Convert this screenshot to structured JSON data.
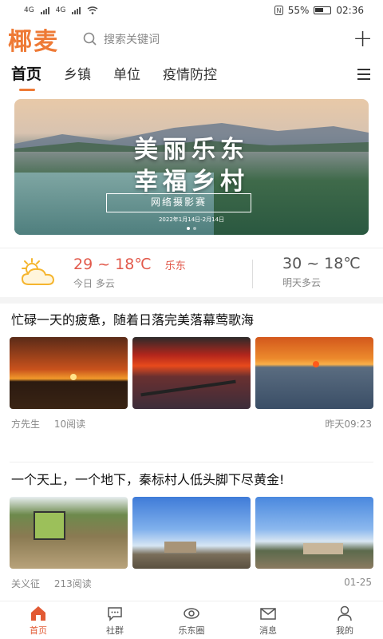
{
  "status_bar": {
    "network1": "4G",
    "network2": "4G",
    "battery": "55%",
    "time": "02:36"
  },
  "header": {
    "logo": "椰麦",
    "search_placeholder": "搜索关键词"
  },
  "tabs": [
    {
      "label": "首页"
    },
    {
      "label": "乡镇"
    },
    {
      "label": "单位"
    },
    {
      "label": "疫情防控"
    }
  ],
  "banner": {
    "title_line1": "美丽乐东",
    "title_line2": "幸福乡村",
    "subtitle": "网络摄影赛",
    "date": "2022年1月14日-2月14日"
  },
  "weather": {
    "today_temp": "29 ~ 18℃",
    "city": "乐东",
    "today_desc": "今日 多云",
    "tomorrow_temp": "30 ~ 18℃",
    "tomorrow_desc": "明天多云"
  },
  "articles": [
    {
      "title": "忙碌一天的疲惫，随着日落完美落幕莺歌海",
      "author": "方先生",
      "reads": "10阅读",
      "time": "昨天09:23"
    },
    {
      "title": "一个天上，一个地下，秦标村人低头脚下尽黄金!",
      "author": "关义征",
      "reads": "213阅读",
      "time": "01-25"
    }
  ],
  "bottom_nav": [
    {
      "label": "首页"
    },
    {
      "label": "社群"
    },
    {
      "label": "乐东圈"
    },
    {
      "label": "消息"
    },
    {
      "label": "我的"
    }
  ],
  "colors": {
    "accent": "#ee7a36",
    "temp_red": "#e25a4c"
  }
}
